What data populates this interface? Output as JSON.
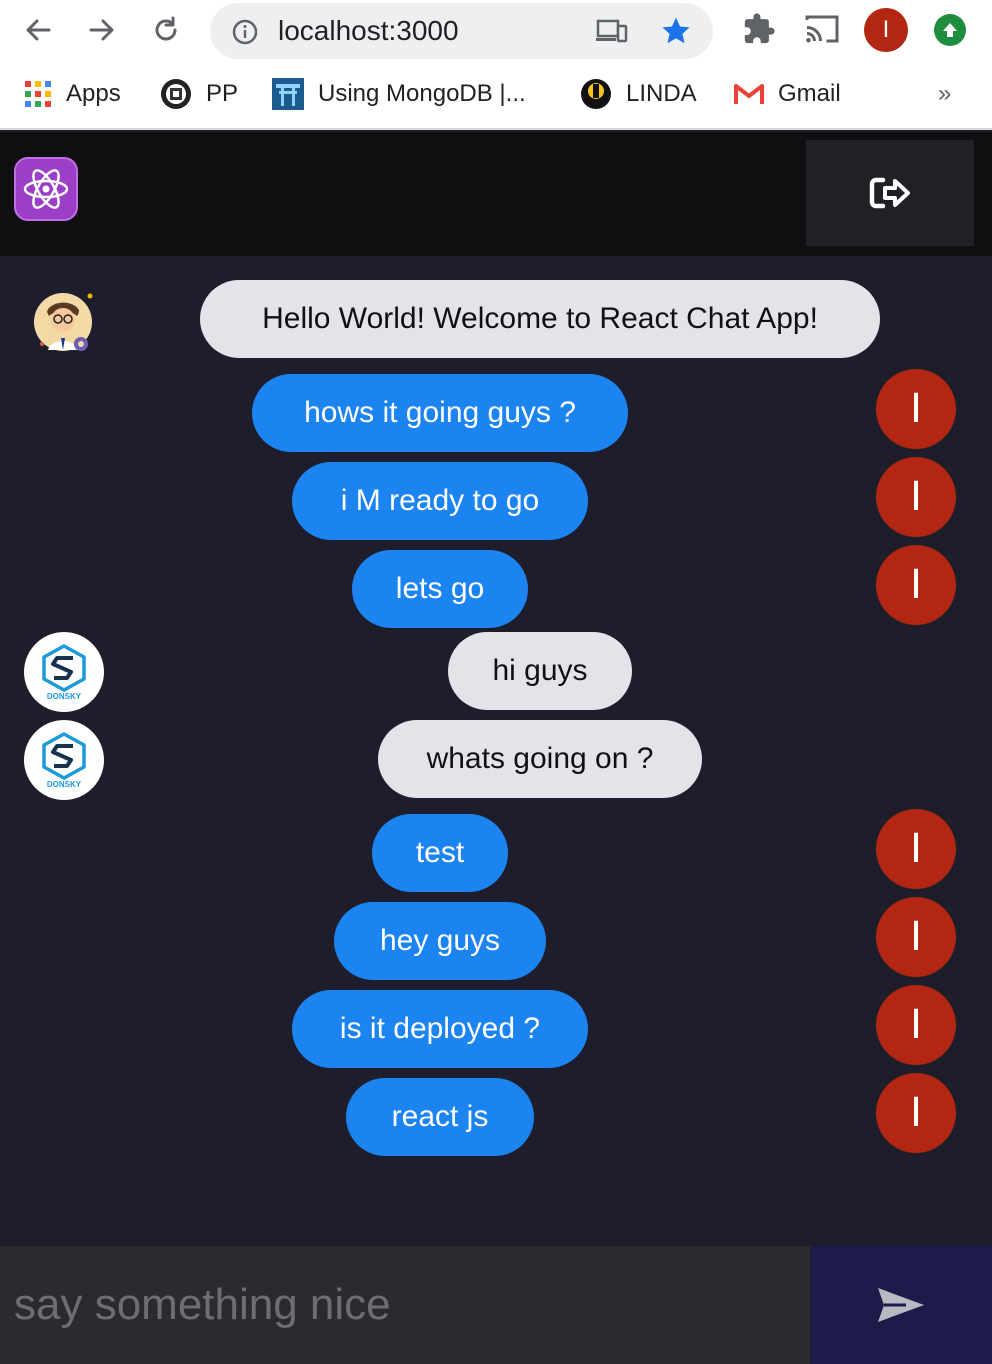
{
  "browser": {
    "url": "localhost:3000",
    "profile_initial": "I",
    "bookmarks": [
      {
        "label": "Apps",
        "icon": "apps-grid-icon"
      },
      {
        "label": "PP",
        "icon": "pp-favicon-icon"
      },
      {
        "label": "Using MongoDB |...",
        "icon": "torii-favicon-icon"
      },
      {
        "label": "LINDA",
        "icon": "linda-favicon-icon"
      },
      {
        "label": "Gmail",
        "icon": "gmail-icon"
      }
    ],
    "bookmarks_more": "»"
  },
  "app": {
    "logo_icon": "react-atom-icon",
    "logout_icon": "sign-out-icon"
  },
  "messages": [
    {
      "text": "Hello World! Welcome to React Chat App!",
      "sender": "admin"
    },
    {
      "text": "hows it going guys ?",
      "sender": "me",
      "avatar": "I"
    },
    {
      "text": "i M ready to go",
      "sender": "me",
      "avatar": "I"
    },
    {
      "text": "lets go",
      "sender": "me",
      "avatar": "I"
    },
    {
      "text": "hi guys",
      "sender": "donsky"
    },
    {
      "text": "whats going on ?",
      "sender": "donsky"
    },
    {
      "text": "test",
      "sender": "me",
      "avatar": "I"
    },
    {
      "text": "hey guys",
      "sender": "me",
      "avatar": "I"
    },
    {
      "text": "is it deployed ?",
      "sender": "me",
      "avatar": "I"
    },
    {
      "text": "react js",
      "sender": "me",
      "avatar": "I"
    }
  ],
  "brand_avatar_text": "DONSKY",
  "composer": {
    "placeholder": "say something nice",
    "value": ""
  },
  "colors": {
    "my_bubble": "#1b84f0",
    "their_bubble": "#e4e3ea",
    "avatar_red": "#b32712",
    "chat_bg": "#1e1d2b"
  }
}
